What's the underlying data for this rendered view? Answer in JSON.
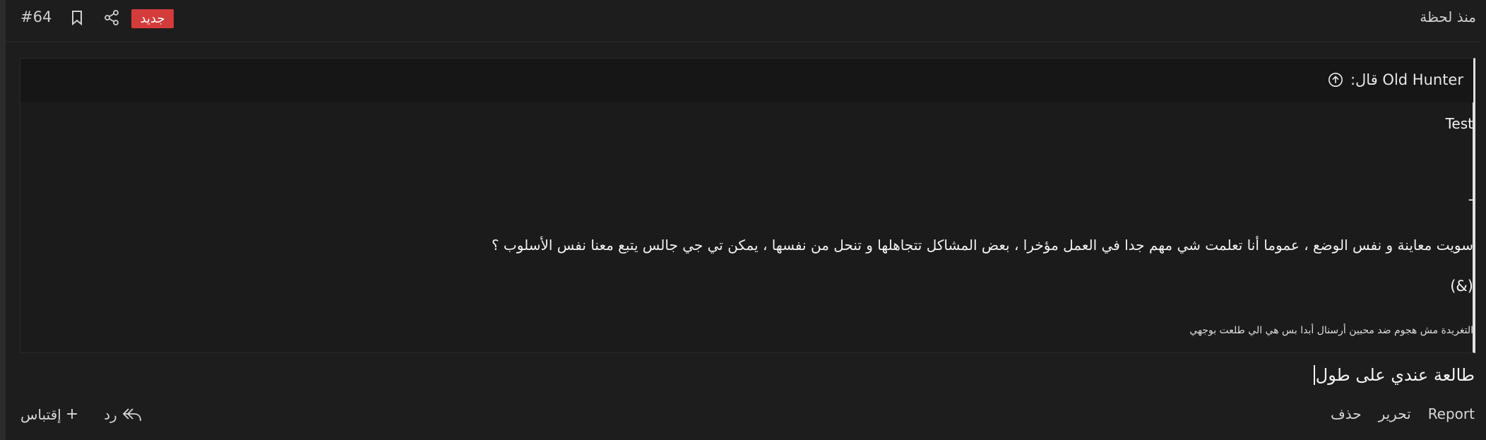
{
  "post": {
    "number": "#64",
    "badge": "جديد",
    "timestamp": "منذ لحظة"
  },
  "quote": {
    "author_line": "Old Hunter قال:",
    "lines": [
      "Test",
      "-",
      "سويت معاينة و نفس الوضع ، عموما أنا تعلمت شي مهم جدا في العمل مؤخرا ، بعض المشاكل تتجاهلها و تنحل من نفسها ، يمكن تي جي جالس يتبع معنا نفس الأسلوب ؟",
      "(&)",
      "التغريدة مش هجوم ضد محبين أرسنال أبدا بس هي الي طلعت بوجهي"
    ]
  },
  "reply": {
    "text": "طالعة عندي على طول"
  },
  "actions": {
    "reply": "رد",
    "quote": "إقتباس",
    "report": "Report",
    "edit": "تحرير",
    "delete": "حذف"
  },
  "icons": {
    "bookmark": "bookmark-icon",
    "share": "share-icon",
    "arrow": "arrow-up-circle-icon",
    "reply": "reply-icon",
    "plus": "plus-icon"
  },
  "colors": {
    "badge": "#d43b3b",
    "background": "#1d1d1d"
  }
}
